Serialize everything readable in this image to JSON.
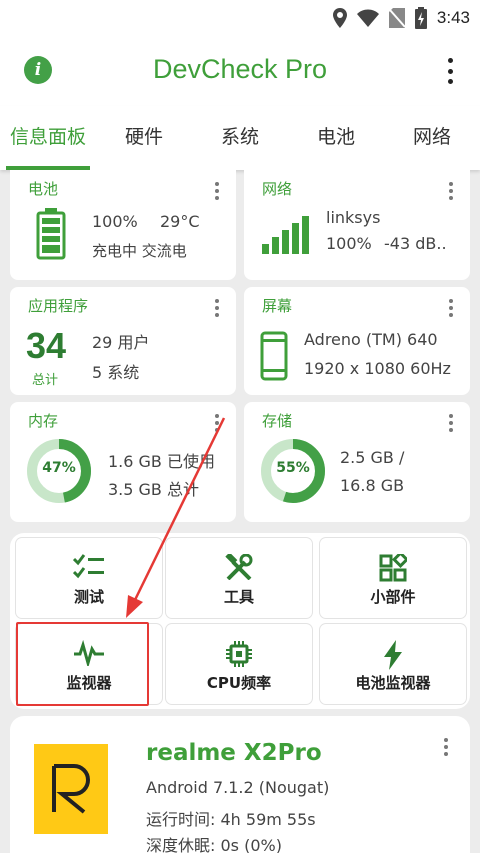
{
  "status": {
    "time": "3:43"
  },
  "app": {
    "title": "DevCheck Pro"
  },
  "tabs": [
    "信息面板",
    "硬件",
    "系统",
    "电池",
    "网络"
  ],
  "cards": {
    "battery": {
      "title": "电池",
      "percent": "100%",
      "temp": "29°C",
      "status": "充电中 交流电"
    },
    "network": {
      "title": "网络",
      "ssid": "linksys",
      "signal": "100%",
      "dbm": "-43 dB.."
    },
    "apps": {
      "title": "应用程序",
      "total": "34",
      "total_label": "总计",
      "user": "29 用户",
      "system": "5 系统"
    },
    "screen": {
      "title": "屏幕",
      "gpu": "Adreno (TM) 640",
      "resolution": "1920 x 1080  60Hz"
    },
    "memory": {
      "title": "内存",
      "percent": "47%",
      "percent_value": 47,
      "used": "1.6 GB 已使用",
      "total": "3.5 GB 总计"
    },
    "storage": {
      "title": "存储",
      "percent": "55%",
      "percent_value": 55,
      "used": "2.5 GB /",
      "total": "16.8 GB"
    }
  },
  "tools": {
    "test": "测试",
    "tools": "工具",
    "widgets": "小部件",
    "monitor": "监视器",
    "cpu": "CPU频率",
    "battery_monitor": "电池监视器"
  },
  "device": {
    "name": "realme X2Pro",
    "android": "Android 7.1.2 (Nougat)",
    "uptime": "运行时间: 4h 59m 55s",
    "deep_sleep": "深度休眠: 0s (0%)"
  },
  "colors": {
    "accent": "#3f9f3a",
    "highlight": "#e53935",
    "logo_bg": "#ffc915"
  }
}
